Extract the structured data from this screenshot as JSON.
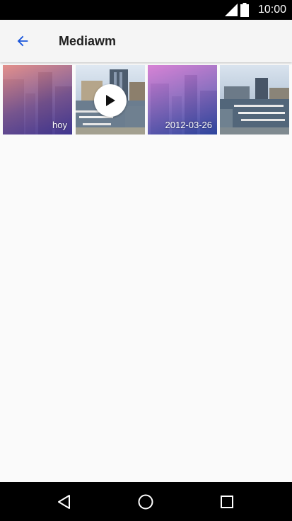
{
  "status_bar": {
    "time": "10:00",
    "icons": [
      "cell-signal-icon",
      "battery-icon"
    ]
  },
  "app_bar": {
    "title": "Mediawm",
    "back_icon": "arrow-back-icon",
    "accent_color": "#1a56db"
  },
  "media_grid": {
    "items": [
      {
        "type": "album",
        "label": "hoy",
        "gradient": [
          "#f08a80",
          "#3a2e8f"
        ]
      },
      {
        "type": "video",
        "label": "",
        "icon": "play-icon"
      },
      {
        "type": "album",
        "label": "2012-03-26",
        "gradient": [
          "#e07ad8",
          "#263f9e"
        ]
      },
      {
        "type": "photo",
        "label": ""
      }
    ]
  },
  "nav_bar": {
    "buttons": [
      "back-triangle-icon",
      "home-circle-icon",
      "recents-square-icon"
    ]
  }
}
